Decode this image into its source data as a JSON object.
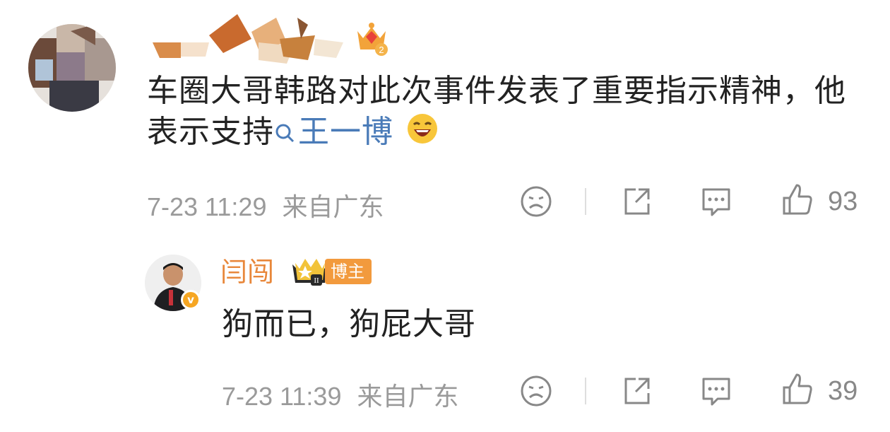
{
  "comment1": {
    "text": "车圈大哥韩路对此次事件发表了重要指示精神，他表示支持",
    "topic": "王一博",
    "time": "7-23 11:29",
    "location": "来自广东",
    "like_count": "93",
    "level_badge": "2"
  },
  "comment2": {
    "username": "闫闯",
    "badge": "博主",
    "level_badge": "II",
    "verify": "v",
    "text": "狗而已，狗屁大哥",
    "time": "7-23 11:39",
    "location": "来自广东",
    "like_count": "39"
  },
  "icons": {
    "react": "sad-face-icon",
    "share": "share-icon",
    "comment": "comment-icon",
    "like": "thumbs-up-icon",
    "topic": "search-icon",
    "emoji": "laughing-emoji-icon"
  },
  "colors": {
    "username_orange": "#e8873a",
    "badge_orange": "#f29a3d",
    "topic_blue": "#4a7bb8",
    "meta_gray": "#9a9a9a"
  }
}
